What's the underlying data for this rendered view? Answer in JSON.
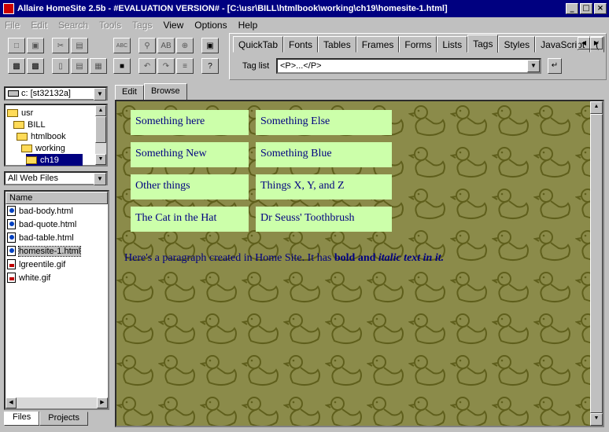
{
  "window": {
    "title": "Allaire HomeSite 2.5b - #EVALUATION VERSION# - [C:\\usr\\BILL\\htmlbook\\working\\ch19\\homesite-1.html]",
    "min": "_",
    "max": "□",
    "close": "×"
  },
  "menu": [
    {
      "label": "File",
      "enabled": false
    },
    {
      "label": "Edit",
      "enabled": false
    },
    {
      "label": "Search",
      "enabled": false
    },
    {
      "label": "Tools",
      "enabled": false
    },
    {
      "label": "Tags",
      "enabled": false
    },
    {
      "label": "View",
      "enabled": true
    },
    {
      "label": "Options",
      "enabled": true
    },
    {
      "label": "Help",
      "enabled": true
    }
  ],
  "toolbar": {
    "spell_label": "ABC",
    "replace_a": "A",
    "replace_b": "B"
  },
  "quicktabs": {
    "tabs": [
      "QuickTab",
      "Fonts",
      "Tables",
      "Frames",
      "Forms",
      "Lists",
      "Tags",
      "Styles",
      "JavaScript",
      "("
    ],
    "active": "Tags",
    "tag_list_label": "Tag list",
    "tag_list_value": "<P>...</P>"
  },
  "left_panel": {
    "drive": "c: [st32132a]",
    "folders": [
      "usr",
      "BILL",
      "htmlbook",
      "working",
      "ch19"
    ],
    "selected_folder": "ch19",
    "filter": "All Web Files",
    "column_name": "Name",
    "files": [
      {
        "name": "bad-body.html",
        "type": "html"
      },
      {
        "name": "bad-quote.html",
        "type": "html"
      },
      {
        "name": "bad-table.html",
        "type": "html"
      },
      {
        "name": "homesite-1.html",
        "type": "html"
      },
      {
        "name": "lgreentile.gif",
        "type": "gif"
      },
      {
        "name": "white.gif",
        "type": "gif"
      }
    ],
    "selected_file": "homesite-1.html",
    "tabs": [
      "Files",
      "Projects"
    ]
  },
  "editor_tabs": [
    "Edit",
    "Browse"
  ],
  "active_editor_tab": "Browse",
  "browse": {
    "cells": [
      [
        "Something here",
        "Something Else"
      ],
      [
        "Something New",
        "Something Blue"
      ],
      [
        "Other things",
        "Things X, Y, and Z"
      ],
      [
        "The Cat in the Hat",
        "Dr Seuss' Toothbrush"
      ]
    ],
    "paragraph_start": "Here's a paragraph created in Home Site. It has ",
    "paragraph_bold": "bold and ",
    "paragraph_bold_italic": "italic text in it.",
    "background_color": "#8b8b4a",
    "cell_color": "#ccffaa",
    "text_color": "#000080"
  }
}
